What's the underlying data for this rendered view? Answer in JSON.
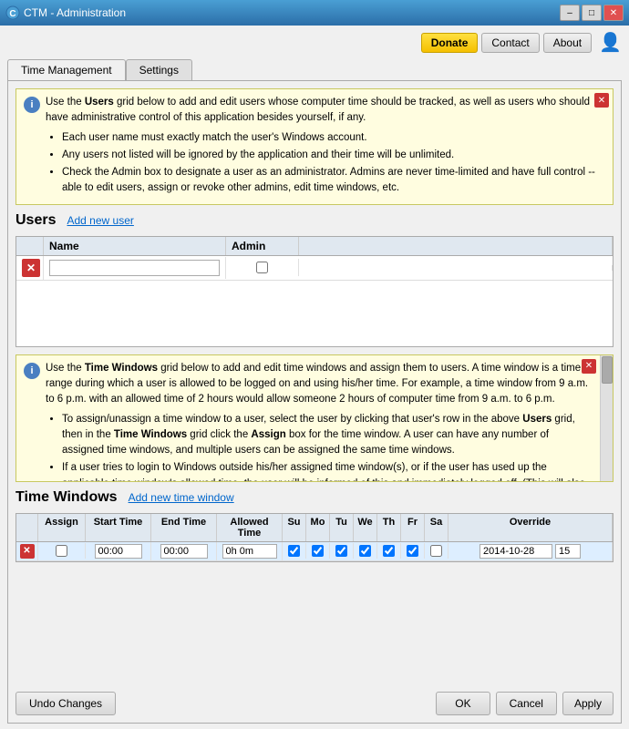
{
  "titlebar": {
    "title": "CTM - Administration",
    "min_btn": "–",
    "max_btn": "□",
    "close_btn": "✕"
  },
  "topbar": {
    "donate_label": "Donate",
    "contact_label": "Contact",
    "about_label": "About"
  },
  "tabs": {
    "tab1": "Time Management",
    "tab2": "Settings"
  },
  "users_section": {
    "title": "Users",
    "add_link": "Add new user",
    "info_text_1": "Use the ",
    "info_bold1": "Users",
    "info_text_2": " grid below to add and edit users whose computer time should be tracked, as well as users who should have administrative control of this application besides yourself, if any.",
    "bullets": [
      "Each user name must exactly match the user's Windows account.",
      "Any users not listed will be ignored by the application and their time will be unlimited.",
      "Check the Admin box to designate a user as an administrator. Admins are never time-limited and have full control -- able to edit users, assign or revoke other admins, edit time windows, etc."
    ],
    "col_name": "Name",
    "col_admin": "Admin"
  },
  "time_windows_section": {
    "title": "Time Windows",
    "add_link": "Add new time window",
    "info_text": "Use the ",
    "info_bold1": "Time Windows",
    "info_text2": " grid below to add and edit time windows and assign them to users. A time window is a time range during which a user is allowed to be logged on and using his/her time. For example, a time window from 9 a.m. to 6 p.m. with an allowed time of 2 hours would allow someone 2 hours of computer time from 9 a.m. to 6 p.m.",
    "bullets": [
      "To assign/unassign a time window to a user, select the user by clicking that user's row in the above Users grid, then in the Time Windows grid click the Assign box for the time window. A user can have any number of assigned time windows, and multiple users can be assigned the same time windows.",
      "If a user tries to login to Windows outside his/her assigned time window(s), or if the user has used up the applicable time window's allowed time, the user will be informed of this and immediately logged off. (This will also happen if no time window has been assigned to the user.)"
    ],
    "col_assign": "Assign",
    "col_start": "Start Time",
    "col_end": "End Time",
    "col_allowed": "Allowed Time",
    "col_su": "Su",
    "col_mo": "Mo",
    "col_tu": "Tu",
    "col_we": "We",
    "col_th": "Th",
    "col_fr": "Fr",
    "col_sa": "Sa",
    "col_override": "Override",
    "row": {
      "start": "00:00",
      "end": "00:00",
      "allowed": "0h 0m",
      "override_date": "2014-10-28",
      "override_num": "15"
    }
  },
  "bottom_bar": {
    "undo_label": "Undo Changes",
    "ok_label": "OK",
    "cancel_label": "Cancel",
    "apply_label": "Apply"
  }
}
